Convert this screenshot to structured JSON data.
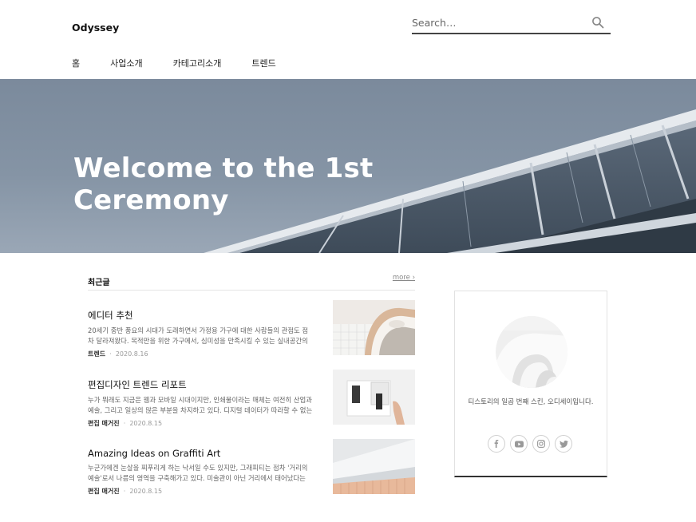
{
  "header": {
    "logo": "Odyssey",
    "search_placeholder": "Search…"
  },
  "nav": [
    {
      "label": "홈"
    },
    {
      "label": "사업소개"
    },
    {
      "label": "카테고리소개"
    },
    {
      "label": "트렌드"
    }
  ],
  "hero": {
    "title_line1": "Welcome to the 1st",
    "title_line2": "Ceremony"
  },
  "recent": {
    "heading": "최근글",
    "more": "more ›",
    "posts": [
      {
        "title": "에디터 추천",
        "excerpt": "20세기 중반 풍요의 시대가 도래하면서 가정용 가구에 대한 사람들의 관점도 점차 달라져왔다. 목적만을 위한 가구에서, 심미성을 만족시킬 수 있는 실내공간의 디...",
        "category": "트렌드",
        "date": "2020.8.16"
      },
      {
        "title": "편집디자인 트렌드 리포트",
        "excerpt": "누가 뭐래도 지금은 웹과 모바일 시대이지만, 인쇄물이라는 매체는 여전히 산업과 예술, 그리고 일상의 많은 부분을 차지하고 있다. 디지털 데이터가 따라할 수 없는 촉...",
        "category": "편집 매거진",
        "date": "2020.8.15"
      },
      {
        "title": "Amazing Ideas on Graffiti Art",
        "excerpt": "누군가에겐 눈살을 찌푸리게 하는 낙서일 수도 있지만, 그래피티는 점차 '거리의 예술'로서 나름의 영역을 구축해가고 있다. 미술관이 아닌 거리에서 태어났다는 점과...",
        "category": "편집 매거진",
        "date": "2020.8.15"
      }
    ],
    "meta_separator": "·"
  },
  "sidebar": {
    "description": "티스토리의 일곱 번째 스킨, 오디세이입니다.",
    "social": [
      {
        "icon": "facebook-icon"
      },
      {
        "icon": "youtube-icon"
      },
      {
        "icon": "instagram-icon"
      },
      {
        "icon": "twitter-icon"
      }
    ]
  },
  "colors": {
    "hero_sky": "#7b8a9c",
    "text_dark": "#111111",
    "text_muted": "#666666"
  }
}
